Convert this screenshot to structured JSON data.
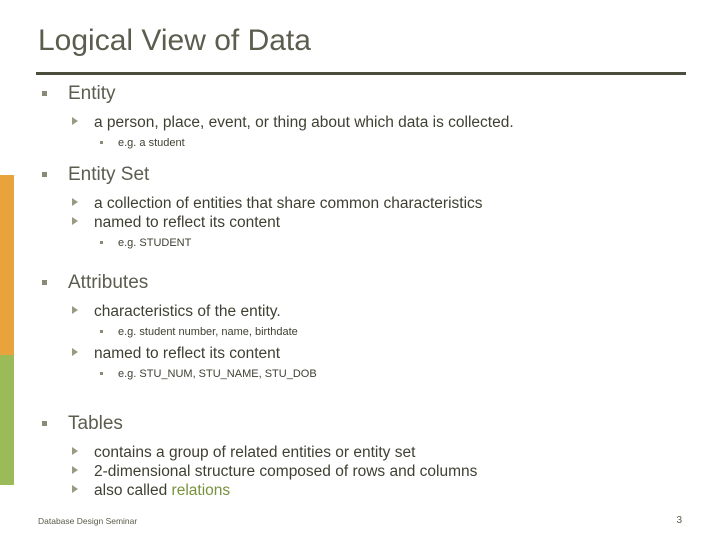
{
  "slide": {
    "title": "Logical View of Data",
    "accent_green": "#9bbb59",
    "accent_orange": "#e8a33d",
    "highlight_color": "#76923c",
    "sections": [
      {
        "heading": "Entity",
        "level2": [
          "a person, place, event, or thing about which data is collected."
        ],
        "level3_after_first": [
          "e.g. a student"
        ]
      },
      {
        "heading": "Entity Set",
        "level2": [
          "a collection of entities that share common characteristics",
          "named to reflect its content"
        ],
        "level3_after_last": [
          "e.g. STUDENT"
        ]
      },
      {
        "heading": "Attributes",
        "pairs": [
          {
            "level2": "characteristics of the entity.",
            "level3": "e.g. student number, name, birthdate"
          },
          {
            "level2": "named to reflect its content",
            "level3": "e.g. STU_NUM, STU_NAME, STU_DOB"
          }
        ]
      },
      {
        "heading": "Tables",
        "level2": [
          "contains a group of related entities or entity set",
          "2-dimensional structure composed of rows and columns"
        ],
        "level2_last_prefix": "also called ",
        "level2_last_highlight": "relations"
      }
    ],
    "footer": {
      "left": "Database Design Seminar",
      "page_number": "3"
    }
  }
}
